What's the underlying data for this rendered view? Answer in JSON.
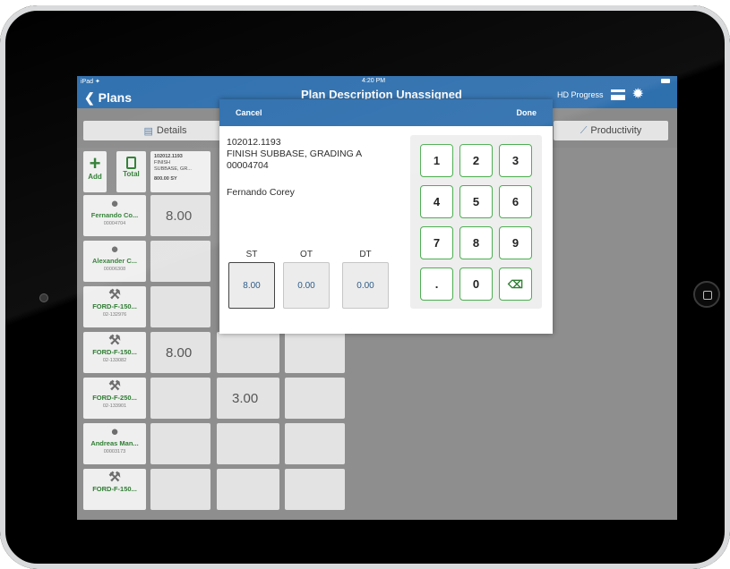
{
  "status": {
    "carrier": "iPad ✦",
    "time": "4:20 PM"
  },
  "nav": {
    "back_label": "Plans",
    "title": "Plan Description Unassigned",
    "logo_text": "HD Progress"
  },
  "tabs": [
    {
      "label": "Details",
      "icon": "document-icon"
    },
    {
      "label": "Productivity",
      "icon": "chart-icon"
    }
  ],
  "grid": {
    "add_label": "Add",
    "total_label": "Total",
    "item_header": {
      "code": "102012.1193",
      "desc1": "FINISH",
      "desc2": "SUBBASE, GR...",
      "qty": "800.00 SY"
    },
    "rows": [
      {
        "name": "Fernando Co...",
        "id": "00004704",
        "icon": "person-icon",
        "values": [
          "8.00",
          "",
          ""
        ]
      },
      {
        "name": "Alexander C...",
        "id": "00006308",
        "icon": "person-icon",
        "values": [
          "",
          "",
          ""
        ]
      },
      {
        "name": "FORD-F-150...",
        "id": "02-132976",
        "icon": "tools-icon",
        "values": [
          "",
          "",
          ""
        ]
      },
      {
        "name": "FORD-F-150...",
        "id": "02-133082",
        "icon": "tools-icon",
        "values": [
          "8.00",
          "",
          ""
        ]
      },
      {
        "name": "FORD-F-250...",
        "id": "02-133901",
        "icon": "tools-icon",
        "values": [
          "",
          "3.00",
          ""
        ]
      },
      {
        "name": "Andreas Man...",
        "id": "00003173",
        "icon": "person-icon",
        "values": [
          "",
          "",
          ""
        ]
      },
      {
        "name": "FORD-F-150...",
        "id": "",
        "icon": "tools-icon",
        "values": [
          "",
          "",
          ""
        ]
      }
    ]
  },
  "modal": {
    "cancel_label": "Cancel",
    "done_label": "Done",
    "item_code": "102012.1193",
    "item_desc": "FINISH SUBBASE, GRADING A",
    "worker_id": "00004704",
    "worker_name": "Fernando Corey",
    "hours": [
      {
        "label": "ST",
        "value": "8.00",
        "active": true
      },
      {
        "label": "OT",
        "value": "0.00",
        "active": false
      },
      {
        "label": "DT",
        "value": "0.00",
        "active": false
      }
    ],
    "keypad": [
      "1",
      "2",
      "3",
      "4",
      "5",
      "6",
      "7",
      "8",
      "9",
      ".",
      "0",
      "⌫"
    ]
  },
  "colors": {
    "nav": "#2e6fae",
    "accent_green": "#2e7d32",
    "key_border": "#4caf50"
  }
}
